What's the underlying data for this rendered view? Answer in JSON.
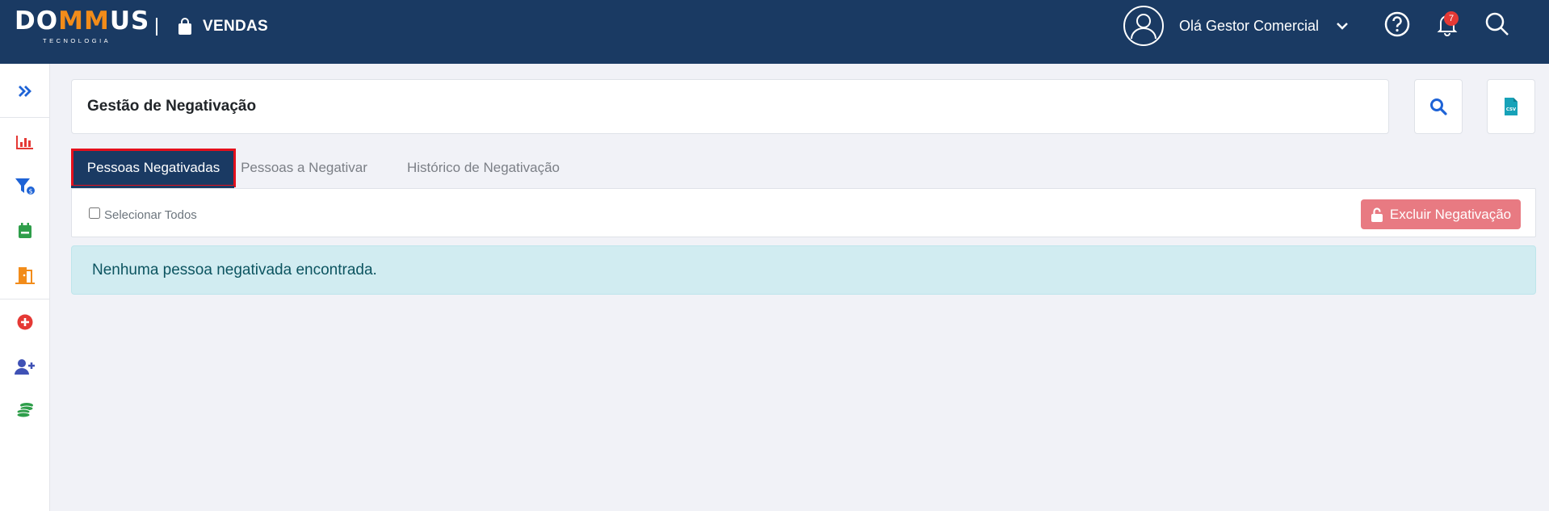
{
  "header": {
    "logo": {
      "text_start": "DO",
      "text_m1": "M",
      "text_m2": "M",
      "text_end": "US",
      "subtitle": "TECNOLOGIA"
    },
    "module_icon": "shopping-bag-icon",
    "module_name": "VENDAS",
    "user_greeting": "Olá Gestor Comercial",
    "notification_count": "7",
    "icons": [
      "user-circle-icon",
      "chevron-down-icon",
      "help-icon",
      "bell-icon",
      "search-icon"
    ],
    "colors": {
      "bar": "#1a3a63",
      "logo_accent": "#f28c1a",
      "badge": "#e53935"
    }
  },
  "sidebar": {
    "items": [
      {
        "icon": "expand-menu-icon",
        "color": "#1e63d6"
      },
      {
        "icon": "bar-chart-icon",
        "color": "#e53935"
      },
      {
        "icon": "funnel-dollar-icon",
        "color": "#1e63d6"
      },
      {
        "icon": "calendar-icon",
        "color": "#2e9e4a"
      },
      {
        "icon": "door-exit-icon",
        "color": "#f28c1a"
      },
      {
        "icon": "plus-circle-icon",
        "color": "#e53935"
      },
      {
        "icon": "user-plus-icon",
        "color": "#3f51b5"
      },
      {
        "icon": "coins-icon",
        "color": "#2e9e4a"
      }
    ]
  },
  "page": {
    "title": "Gestão de Negativação",
    "actions": [
      {
        "icon": "search-icon",
        "color": "#1e63d6"
      },
      {
        "icon": "csv-file-icon",
        "color": "#17a2b8"
      }
    ]
  },
  "tabs": [
    {
      "label": "Pessoas Negativadas",
      "active": true
    },
    {
      "label": "Pessoas a Negativar",
      "active": false
    },
    {
      "label": "Histórico de Negativação",
      "active": false
    }
  ],
  "toolbar": {
    "select_all_label": "Selecionar Todos",
    "select_all_checked": false,
    "delete_button_label": "Excluir Negativação",
    "delete_button_icon": "unlock-icon",
    "delete_button_color": "#e87a82"
  },
  "alert": {
    "message": "Nenhuma pessoa negativada encontrada."
  }
}
